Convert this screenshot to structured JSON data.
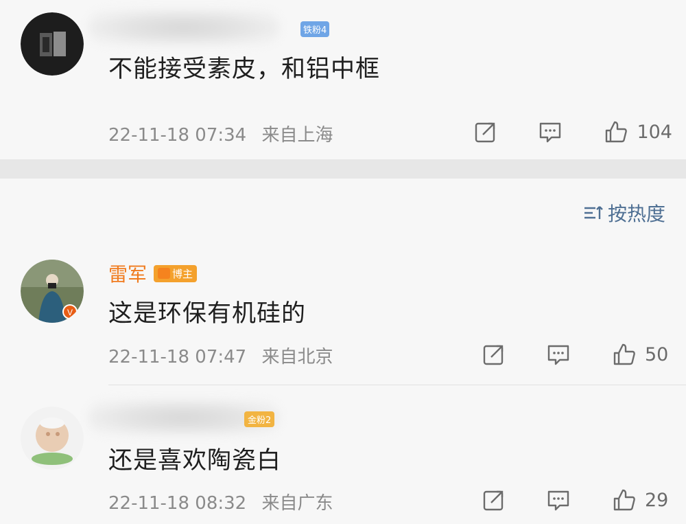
{
  "comments": [
    {
      "user": {
        "name": "",
        "badge": "铁粉4",
        "badge_color": "#6fa5e6"
      },
      "text": "不能接受素皮，和铝中框",
      "time": "22-11-18 07:34",
      "location": "来自上海",
      "likes": "104",
      "avatar_icon": "dark-square-avatar"
    },
    {
      "user": {
        "name": "雷军",
        "badge": "博主",
        "badge_color": "#f4a12d",
        "verified": "V"
      },
      "text": "这是环保有机硅的",
      "time": "22-11-18 07:47",
      "location": "来自北京",
      "likes": "50",
      "avatar_icon": "photographer-avatar"
    },
    {
      "user": {
        "name": "",
        "badge": "金粉2",
        "badge_color": "#f2b442"
      },
      "text": "还是喜欢陶瓷白",
      "time": "22-11-18 08:32",
      "location": "来自广东",
      "likes": "29",
      "avatar_icon": "figurine-avatar"
    }
  ],
  "sort": {
    "label": "按热度",
    "icon": "sort-icon"
  },
  "colors": {
    "username": "#f07b1e",
    "meta": "#8a8a8a",
    "sort": "#4e6f93",
    "separator": "#e7e7e7"
  },
  "icons": {
    "share": "share-icon",
    "comment": "comment-icon",
    "like": "thumbs-up-icon"
  }
}
